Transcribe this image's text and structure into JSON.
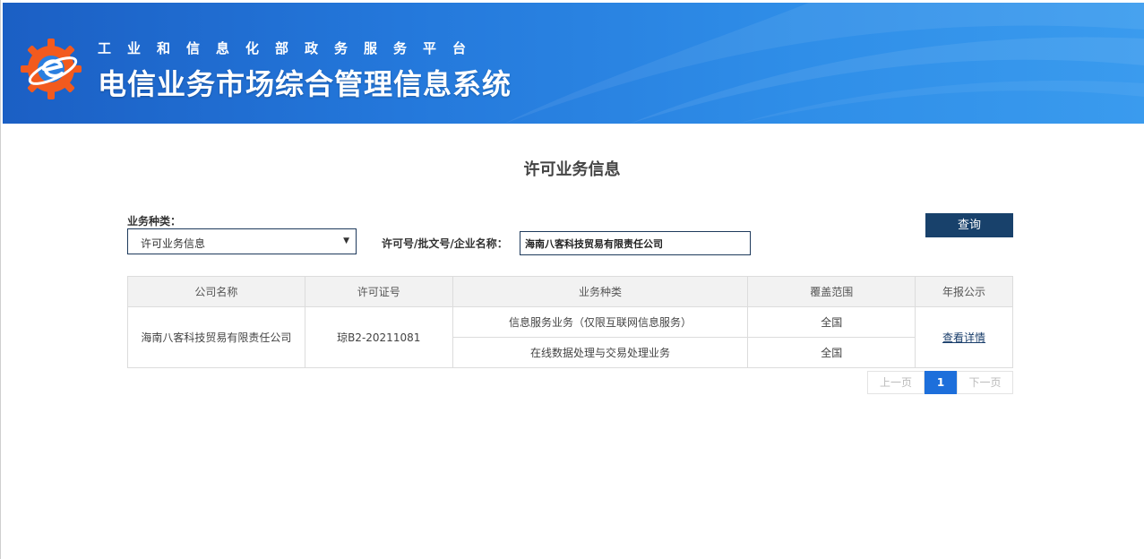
{
  "header": {
    "subtitle": "工业和信息化部政务服务平台",
    "title": "电信业务市场综合管理信息系统"
  },
  "page": {
    "title": "许可业务信息"
  },
  "filters": {
    "type_label": "业务种类：",
    "type_selected": "许可业务信息",
    "search_label": "许可号/批文号/企业名称：",
    "search_value": "海南八客科技贸易有限责任公司",
    "query_button": "查询"
  },
  "table": {
    "headers": [
      "公司名称",
      "许可证号",
      "业务种类",
      "覆盖范围",
      "年报公示"
    ],
    "rows": [
      {
        "company": "海南八客科技贸易有限责任公司",
        "license": "琼B2-20211081",
        "services": [
          {
            "type": "信息服务业务（仅限互联网信息服务）",
            "coverage": "全国"
          },
          {
            "type": "在线数据处理与交易处理业务",
            "coverage": "全国"
          }
        ],
        "report_link": "查看详情"
      }
    ]
  },
  "pagination": {
    "prev": "上一页",
    "current": "1",
    "next": "下一页"
  },
  "colors": {
    "banner": "#2478db",
    "button": "#18416b",
    "page_active": "#1d6fdb",
    "logo_orange": "#f25a1e"
  },
  "icons": {
    "logo": "gear-logo-icon",
    "select_arrow": "caret-down-icon"
  }
}
